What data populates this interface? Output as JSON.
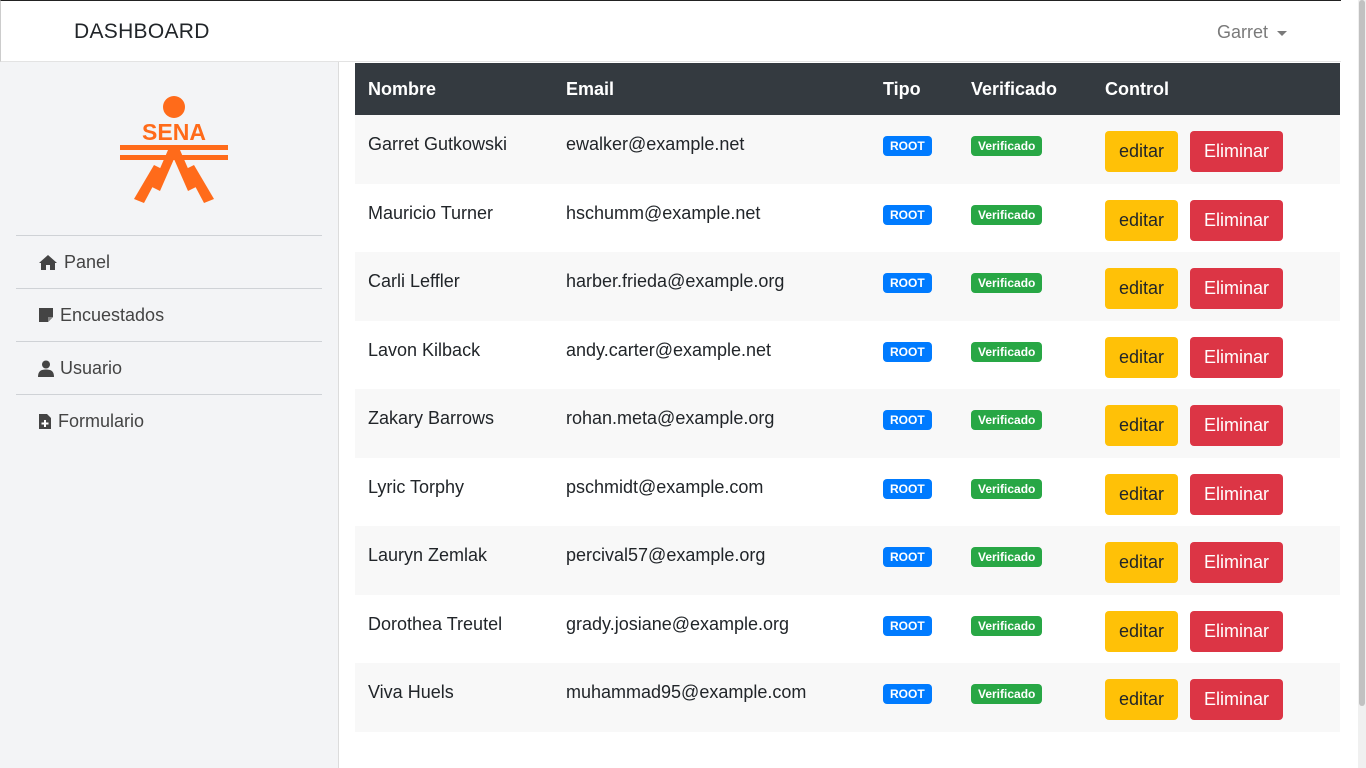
{
  "header": {
    "brand": "DASHBOARD",
    "user": "Garret"
  },
  "sidebar": {
    "logo_text": "SENA",
    "items": [
      {
        "label": "Panel",
        "icon": "home-icon"
      },
      {
        "label": "Encuestados",
        "icon": "sticky-note-icon"
      },
      {
        "label": "Usuario",
        "icon": "user-icon"
      },
      {
        "label": "Formulario",
        "icon": "file-plus-icon"
      }
    ]
  },
  "table": {
    "headers": [
      "Nombre",
      "Email",
      "Tipo",
      "Verificado",
      "Control"
    ],
    "rows": [
      {
        "nombre": "Garret Gutkowski",
        "email": "ewalker@example.net",
        "tipo": "ROOT",
        "verificado": "Verificado",
        "edit": "editar",
        "delete": "Eliminar"
      },
      {
        "nombre": "Mauricio Turner",
        "email": "hschumm@example.net",
        "tipo": "ROOT",
        "verificado": "Verificado",
        "edit": "editar",
        "delete": "Eliminar"
      },
      {
        "nombre": "Carli Leffler",
        "email": "harber.frieda@example.org",
        "tipo": "ROOT",
        "verificado": "Verificado",
        "edit": "editar",
        "delete": "Eliminar"
      },
      {
        "nombre": "Lavon Kilback",
        "email": "andy.carter@example.net",
        "tipo": "ROOT",
        "verificado": "Verificado",
        "edit": "editar",
        "delete": "Eliminar"
      },
      {
        "nombre": "Zakary Barrows",
        "email": "rohan.meta@example.org",
        "tipo": "ROOT",
        "verificado": "Verificado",
        "edit": "editar",
        "delete": "Eliminar"
      },
      {
        "nombre": "Lyric Torphy",
        "email": "pschmidt@example.com",
        "tipo": "ROOT",
        "verificado": "Verificado",
        "edit": "editar",
        "delete": "Eliminar"
      },
      {
        "nombre": "Lauryn Zemlak",
        "email": "percival57@example.org",
        "tipo": "ROOT",
        "verificado": "Verificado",
        "edit": "editar",
        "delete": "Eliminar"
      },
      {
        "nombre": "Dorothea Treutel",
        "email": "grady.josiane@example.org",
        "tipo": "ROOT",
        "verificado": "Verificado",
        "edit": "editar",
        "delete": "Eliminar"
      },
      {
        "nombre": "Viva Huels",
        "email": "muhammad95@example.com",
        "tipo": "ROOT",
        "verificado": "Verificado",
        "edit": "editar",
        "delete": "Eliminar"
      }
    ]
  },
  "colors": {
    "accent_logo": "#ff6b1a",
    "header_bg": "#343a40",
    "root_badge": "#007bff",
    "verified_badge": "#28a745",
    "edit_button": "#ffc107",
    "delete_button": "#dc3545"
  }
}
